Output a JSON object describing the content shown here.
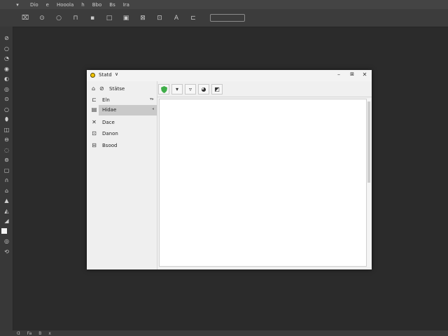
{
  "menubar": {
    "items": [
      "Dio",
      "e",
      "Hooola",
      "h",
      "Bbo",
      "Bs",
      "Ira"
    ]
  },
  "optionbar": {
    "icons": [
      "brush-preset-icon",
      "eraser-icon",
      "circle-icon",
      "layers-icon",
      "square-icon",
      "frame-icon",
      "image-icon",
      "crop-icon",
      "gallery-icon",
      "text-icon",
      "align-icon"
    ]
  },
  "tools": {
    "icons": [
      "move-icon",
      "lasso-icon",
      "magic-wand-icon",
      "crop-tool-icon",
      "eyedropper-icon",
      "healing-icon",
      "brush-icon",
      "stamp-icon",
      "history-brush-icon",
      "eraser-tool-icon",
      "gradient-icon",
      "blur-icon",
      "dodge-icon",
      "pen-icon",
      "text-tool-icon",
      "path-select-icon",
      "shape-icon",
      "hand-icon",
      "zoom-icon",
      "color-swatch-icon",
      "quick-mask-icon",
      "screen-mode-icon"
    ]
  },
  "dialog": {
    "title": "Statd",
    "nav_header": "Stätse",
    "nav_items": [
      {
        "label": "Eln",
        "icon": "drive-icon"
      },
      {
        "label": "Hidae",
        "icon": "picture-icon",
        "selected": true
      },
      {
        "label": "Dace",
        "icon": "close-icon"
      },
      {
        "label": "Danon",
        "icon": "document-icon"
      },
      {
        "label": "Bsood",
        "icon": "box-icon"
      }
    ],
    "toolbar": [
      "shield-icon",
      "filter-icon",
      "funnel-icon",
      "eye-icon",
      "export-icon"
    ],
    "scroll": {
      "position": 0,
      "visible_fraction": 0.5
    }
  },
  "statusbar": {
    "items": [
      "Ɑ",
      "Fa",
      "B",
      "x"
    ]
  },
  "colors": {
    "app_bg": "#2b2b2b",
    "dialog_bg": "#f0f0f0",
    "selection": "#c9c9c9",
    "app_icon": "#f2c400",
    "shield": "#3fae49"
  }
}
